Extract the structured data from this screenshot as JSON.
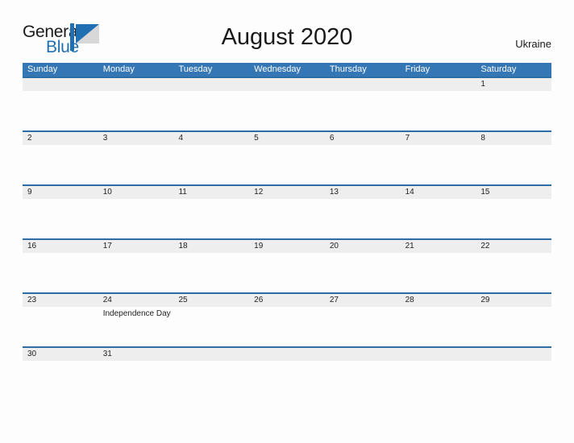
{
  "brand": {
    "name_part1": "General",
    "name_part2": "Blue",
    "logo_icon": "triangle-flag-icon",
    "accent_color": "#1f6fb2"
  },
  "header": {
    "title": "August 2020",
    "region": "Ukraine"
  },
  "colors": {
    "header_bar": "#3576b5",
    "row_divider": "#2e6da4",
    "date_band": "#eeeeee",
    "page_background": "#fdfdfd",
    "text": "#222222"
  },
  "weekdays": [
    "Sunday",
    "Monday",
    "Tuesday",
    "Wednesday",
    "Thursday",
    "Friday",
    "Saturday"
  ],
  "weeks": [
    {
      "days": [
        {
          "date": "",
          "event": ""
        },
        {
          "date": "",
          "event": ""
        },
        {
          "date": "",
          "event": ""
        },
        {
          "date": "",
          "event": ""
        },
        {
          "date": "",
          "event": ""
        },
        {
          "date": "",
          "event": ""
        },
        {
          "date": "1",
          "event": ""
        }
      ]
    },
    {
      "days": [
        {
          "date": "2",
          "event": ""
        },
        {
          "date": "3",
          "event": ""
        },
        {
          "date": "4",
          "event": ""
        },
        {
          "date": "5",
          "event": ""
        },
        {
          "date": "6",
          "event": ""
        },
        {
          "date": "7",
          "event": ""
        },
        {
          "date": "8",
          "event": ""
        }
      ]
    },
    {
      "days": [
        {
          "date": "9",
          "event": ""
        },
        {
          "date": "10",
          "event": ""
        },
        {
          "date": "11",
          "event": ""
        },
        {
          "date": "12",
          "event": ""
        },
        {
          "date": "13",
          "event": ""
        },
        {
          "date": "14",
          "event": ""
        },
        {
          "date": "15",
          "event": ""
        }
      ]
    },
    {
      "days": [
        {
          "date": "16",
          "event": ""
        },
        {
          "date": "17",
          "event": ""
        },
        {
          "date": "18",
          "event": ""
        },
        {
          "date": "19",
          "event": ""
        },
        {
          "date": "20",
          "event": ""
        },
        {
          "date": "21",
          "event": ""
        },
        {
          "date": "22",
          "event": ""
        }
      ]
    },
    {
      "days": [
        {
          "date": "23",
          "event": ""
        },
        {
          "date": "24",
          "event": "Independence Day"
        },
        {
          "date": "25",
          "event": ""
        },
        {
          "date": "26",
          "event": ""
        },
        {
          "date": "27",
          "event": ""
        },
        {
          "date": "28",
          "event": ""
        },
        {
          "date": "29",
          "event": ""
        }
      ]
    },
    {
      "days": [
        {
          "date": "30",
          "event": ""
        },
        {
          "date": "31",
          "event": ""
        },
        {
          "date": "",
          "event": ""
        },
        {
          "date": "",
          "event": ""
        },
        {
          "date": "",
          "event": ""
        },
        {
          "date": "",
          "event": ""
        },
        {
          "date": "",
          "event": ""
        }
      ]
    }
  ]
}
